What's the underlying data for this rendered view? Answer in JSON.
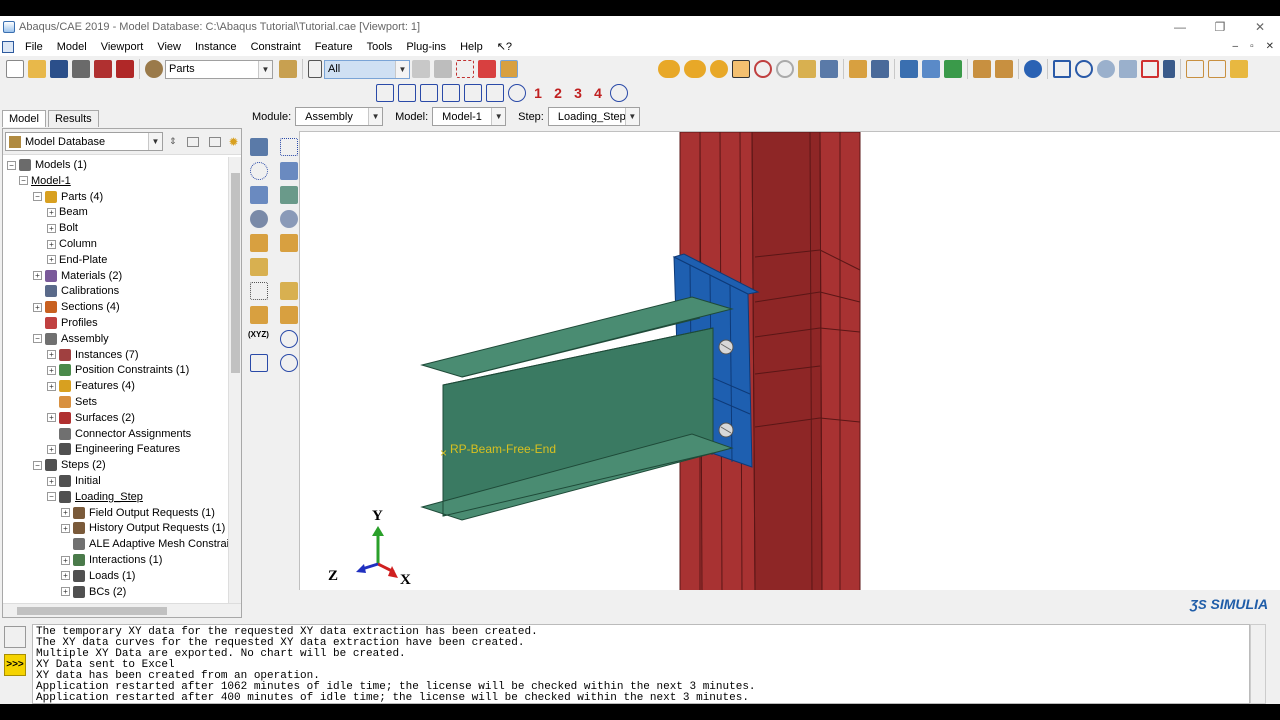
{
  "window": {
    "title": "Abaqus/CAE 2019 - Model Database: C:\\Abaqus Tutorial\\Tutorial.cae [Viewport: 1]",
    "controls": [
      "—",
      "❐",
      "✕"
    ]
  },
  "menu": {
    "items": [
      "File",
      "Model",
      "Viewport",
      "View",
      "Instance",
      "Constraint",
      "Feature",
      "Tools",
      "Plug-ins",
      "Help",
      "↖?"
    ],
    "mdi_controls": [
      "–",
      "▫",
      "✕"
    ]
  },
  "toolbar": {
    "parts_combo": "Parts",
    "selection_filter": "All",
    "dof_labels": [
      "1",
      "2",
      "3",
      "4"
    ]
  },
  "context": {
    "module_label": "Module:",
    "module_value": "Assembly",
    "model_label": "Model:",
    "model_value": "Model-1",
    "step_label": "Step:",
    "step_value": "Loading_Step"
  },
  "tabs": [
    "Model",
    "Results"
  ],
  "tree_header": "Model Database",
  "tree": [
    {
      "label": "Models (1)",
      "level": 0,
      "exp": "−",
      "icon": "#6b6b6b"
    },
    {
      "label": "Model-1",
      "level": 1,
      "exp": "−",
      "icon": "",
      "underline": true
    },
    {
      "label": "Parts (4)",
      "level": 2,
      "exp": "−",
      "icon": "#d8a020"
    },
    {
      "label": "Beam",
      "level": 3,
      "exp": "+",
      "icon": ""
    },
    {
      "label": "Bolt",
      "level": 3,
      "exp": "+",
      "icon": ""
    },
    {
      "label": "Column",
      "level": 3,
      "exp": "+",
      "icon": ""
    },
    {
      "label": "End-Plate",
      "level": 3,
      "exp": "+",
      "icon": ""
    },
    {
      "label": "Materials (2)",
      "level": 2,
      "exp": "+",
      "icon": "#7a5a9a"
    },
    {
      "label": "Calibrations",
      "level": 2,
      "exp": "",
      "icon": "#5a6a8a"
    },
    {
      "label": "Sections (4)",
      "level": 2,
      "exp": "+",
      "icon": "#c86020"
    },
    {
      "label": "Profiles",
      "level": 2,
      "exp": "",
      "icon": "#c04040"
    },
    {
      "label": "Assembly",
      "level": 2,
      "exp": "−",
      "icon": "#707070"
    },
    {
      "label": "Instances (7)",
      "level": 3,
      "exp": "+",
      "icon": "#a04040"
    },
    {
      "label": "Position Constraints (1)",
      "level": 3,
      "exp": "+",
      "icon": "#4a8a4a"
    },
    {
      "label": "Features (4)",
      "level": 3,
      "exp": "+",
      "icon": "#d8a020"
    },
    {
      "label": "Sets",
      "level": 3,
      "exp": "",
      "icon": "#d89040"
    },
    {
      "label": "Surfaces (2)",
      "level": 3,
      "exp": "+",
      "icon": "#b03030"
    },
    {
      "label": "Connector Assignments",
      "level": 3,
      "exp": "",
      "icon": "#707070"
    },
    {
      "label": "Engineering Features",
      "level": 3,
      "exp": "+",
      "icon": "#505050"
    },
    {
      "label": "Steps (2)",
      "level": 2,
      "exp": "−",
      "icon": "#505050"
    },
    {
      "label": "Initial",
      "level": 3,
      "exp": "+",
      "icon": "#505050"
    },
    {
      "label": "Loading_Step",
      "level": 3,
      "exp": "−",
      "icon": "#505050",
      "underline": true
    },
    {
      "label": "Field Output Requests (1)",
      "level": 4,
      "exp": "+",
      "icon": "#7a5a3a"
    },
    {
      "label": "History Output Requests (1)",
      "level": 4,
      "exp": "+",
      "icon": "#7a5a3a"
    },
    {
      "label": "ALE Adaptive Mesh Constraints",
      "level": 4,
      "exp": "",
      "icon": "#707070"
    },
    {
      "label": "Interactions (1)",
      "level": 4,
      "exp": "+",
      "icon": "#4a7a4a"
    },
    {
      "label": "Loads (1)",
      "level": 4,
      "exp": "+",
      "icon": "#505050"
    },
    {
      "label": "BCs (2)",
      "level": 4,
      "exp": "+",
      "icon": "#505050"
    }
  ],
  "viewport": {
    "reference_point_label": "RP-Beam-Free-End",
    "triad": {
      "y": "Y",
      "z": "Z",
      "x": "X"
    },
    "colors": {
      "column": "#a83232",
      "column_dark": "#8e2626",
      "beam": "#3a7a62",
      "beam_top": "#4a8c72",
      "end_plate": "#1e5fb0"
    }
  },
  "brand": "SIMULIA",
  "messages": [
    "The temporary XY data for the requested XY data extraction has been created.",
    "The XY data curves for the requested XY data extraction have been created.",
    "Multiple XY Data are exported. No chart will be created.",
    "XY Data sent to Excel",
    "XY data has been created from an operation.",
    "Application restarted after 1062 minutes of idle time; the license will be checked within the next 3 minutes.",
    "Application restarted after 400 minutes of idle time; the license will be checked within the next 3 minutes."
  ]
}
